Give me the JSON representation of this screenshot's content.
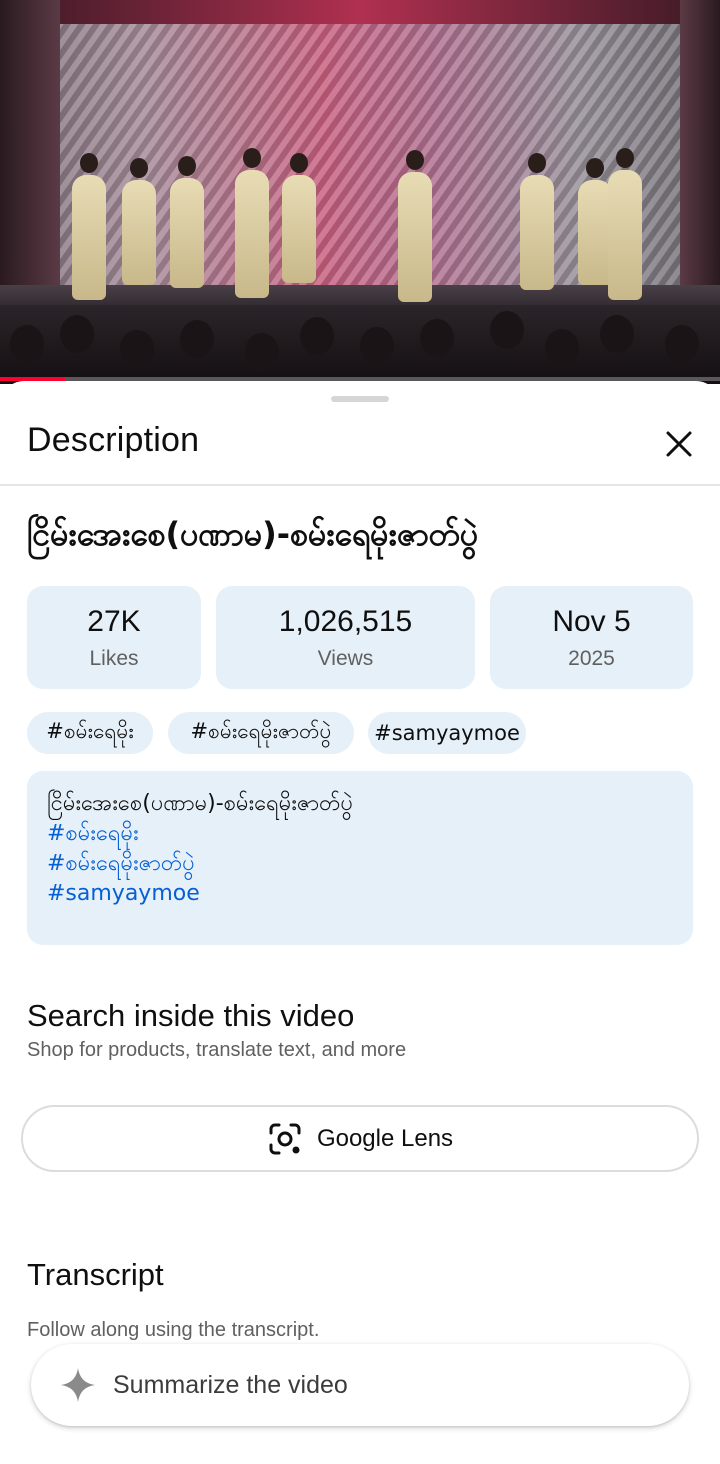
{
  "video": {
    "progress_fraction": 0.09
  },
  "sheet": {
    "title": "Description",
    "close_icon": "close-icon"
  },
  "video_info": {
    "title": "ငြိမ်းအေးစေ(ပဏာမ)-စမ်းရေမိုးဇာတ်ပွဲ",
    "stats": [
      {
        "value": "27K",
        "label": "Likes"
      },
      {
        "value": "1,026,515",
        "label": "Views"
      },
      {
        "value": "Nov 5",
        "label": "2025"
      }
    ],
    "tags": [
      "#စမ်းရေမိုး",
      "#စမ်းရေမိုးဇာတ်ပွဲ",
      "#samyaymoe"
    ]
  },
  "description": {
    "text": "ငြိမ်းအေးစေ(ပဏာမ)-စမ်းရေမိုးဇာတ်ပွဲ",
    "links": [
      "#စမ်းရေမိုး",
      "#စမ်းရေမိုးဇာတ်ပွဲ",
      "#samyaymoe"
    ]
  },
  "search_section": {
    "title": "Search inside this video",
    "subtitle": "Shop for products, translate text, and more",
    "lens_label": "Google Lens",
    "lens_icon": "google-lens-icon"
  },
  "transcript_section": {
    "title": "Transcript",
    "subtitle": "Follow along using the transcript."
  },
  "summarize": {
    "label": "Summarize the video",
    "icon": "sparkle-icon"
  },
  "colors": {
    "accent_red": "#ff0033",
    "chip_bg": "#e6f0f8",
    "link_blue": "#065fd4"
  }
}
